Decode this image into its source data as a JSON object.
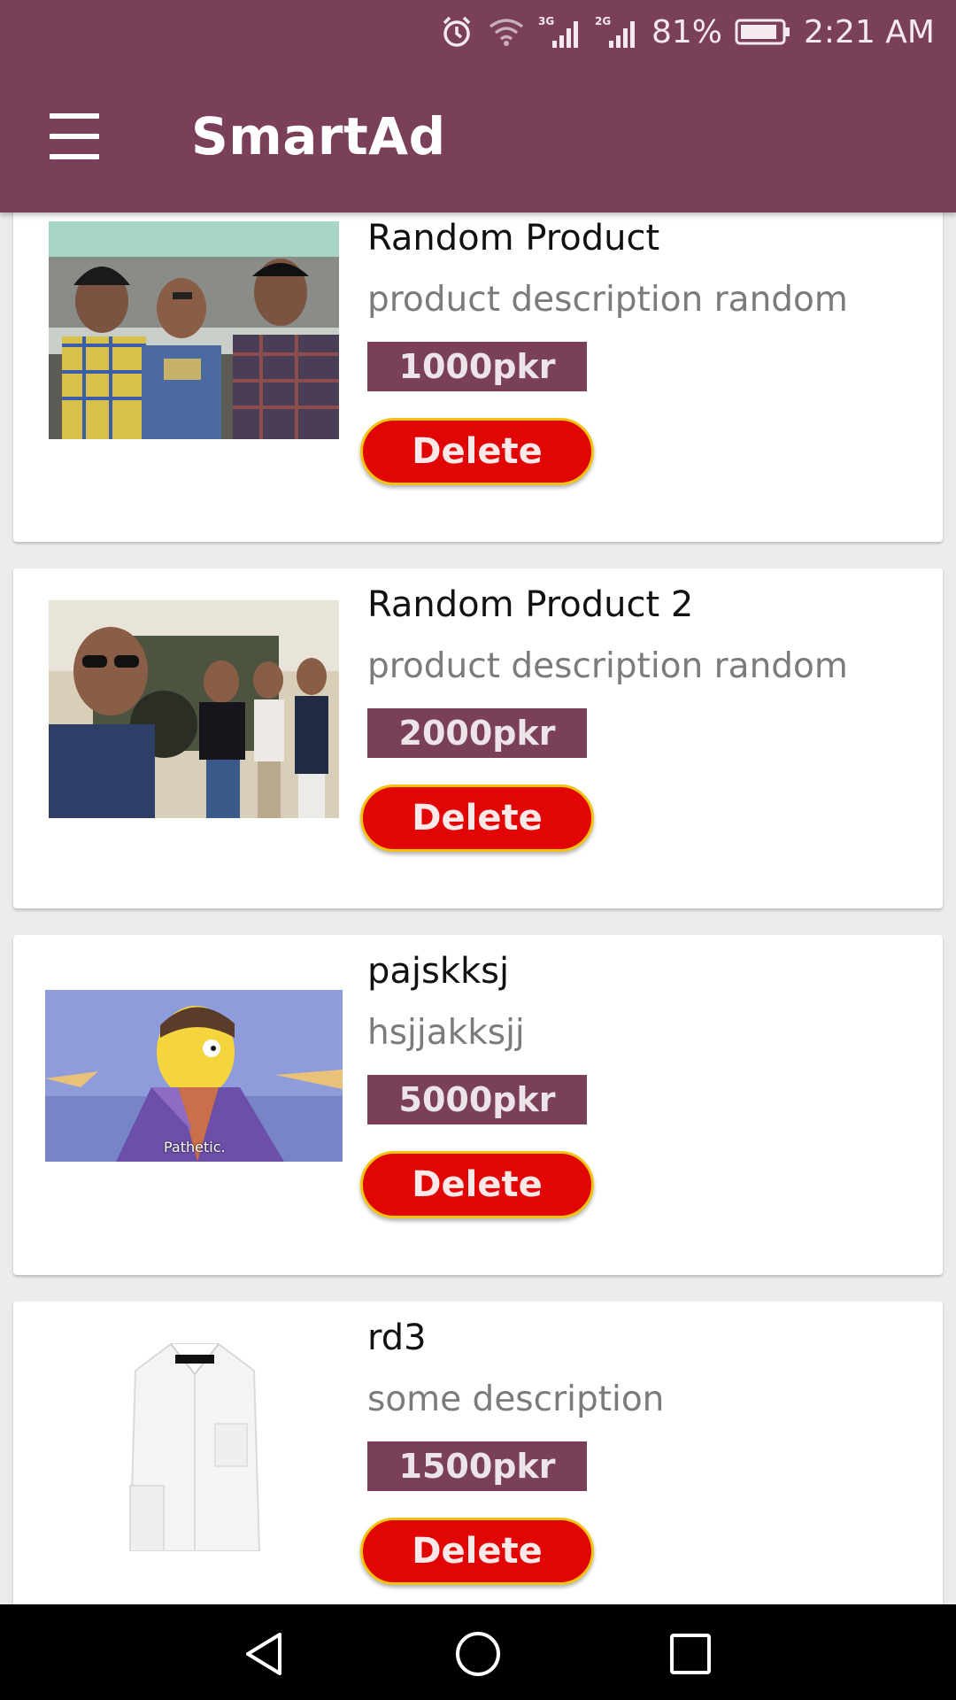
{
  "status_bar": {
    "battery": "81%",
    "time": "2:21 AM",
    "icons": [
      "alarm-icon",
      "wifi-icon",
      "signal-3g-icon",
      "signal-2g-icon",
      "battery-icon"
    ]
  },
  "app_bar": {
    "title": "SmartAd",
    "menu_icon": "hamburger-menu-icon",
    "color": "#7a3f59"
  },
  "products": [
    {
      "title": "Random Product",
      "description": "product description random",
      "price": "1000pkr",
      "delete_label": "Delete"
    },
    {
      "title": "Random Product 2",
      "description": "product description random",
      "price": "2000pkr",
      "delete_label": "Delete"
    },
    {
      "title": "pajskksj",
      "description": "hsjjakksjj",
      "price": "5000pkr",
      "delete_label": "Delete",
      "image_caption": "Pathetic."
    },
    {
      "title": "rd3",
      "description": "some description",
      "price": "1500pkr",
      "delete_label": "Delete"
    }
  ],
  "colors": {
    "brand": "#7a3f59",
    "delete_button": "#e20505",
    "delete_border": "#f1c40f"
  },
  "nav_bar": {
    "icons": [
      "back-icon",
      "home-icon",
      "recents-icon"
    ]
  }
}
